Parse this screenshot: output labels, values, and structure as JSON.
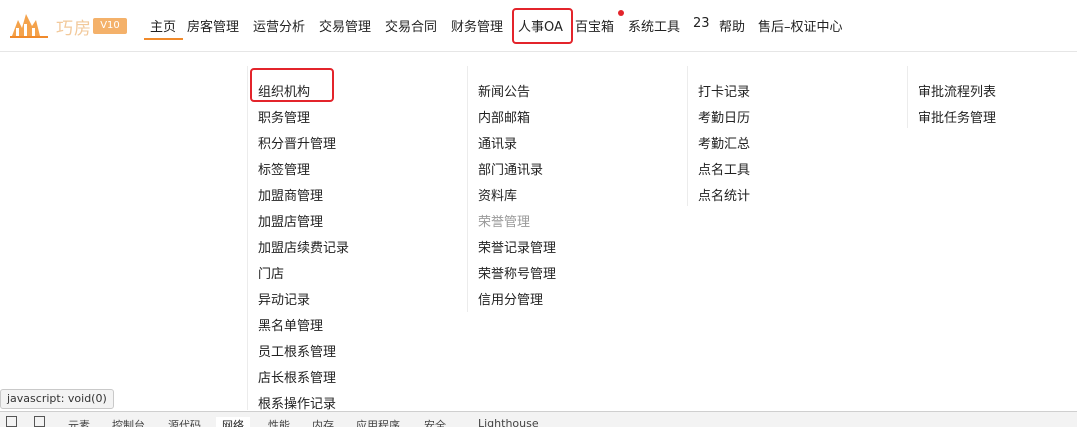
{
  "header": {
    "brand": "巧房",
    "version": "V10",
    "nav": [
      {
        "label": "主页"
      },
      {
        "label": "房客管理"
      },
      {
        "label": "运营分析"
      },
      {
        "label": "交易管理"
      },
      {
        "label": "交易合同"
      },
      {
        "label": "财务管理"
      },
      {
        "label": "人事OA"
      },
      {
        "label": "百宝箱"
      },
      {
        "label": "系统工具"
      },
      {
        "label": "23"
      },
      {
        "label": "帮助"
      },
      {
        "label": "售后–权证中心"
      }
    ],
    "colors": {
      "accent": "#f08a2b",
      "highlight": "#e3242b"
    }
  },
  "menu": {
    "col1": [
      "组织机构",
      "职务管理",
      "积分晋升管理",
      "标签管理",
      "加盟商管理",
      "加盟店管理",
      "加盟店续费记录",
      "门店",
      "异动记录",
      "黑名单管理",
      "员工根系管理",
      "店长根系管理",
      "根系操作记录"
    ],
    "col2": [
      "新闻公告",
      "内部邮箱",
      "通讯录",
      "部门通讯录",
      "资料库",
      "荣誉管理",
      "荣誉记录管理",
      "荣誉称号管理",
      "信用分管理"
    ],
    "col3": [
      "打卡记录",
      "考勤日历",
      "考勤汇总",
      "点名工具",
      "点名统计"
    ],
    "col4": [
      "审批流程列表",
      "审批任务管理"
    ]
  },
  "status_bar": {
    "url": "javascript: void(0)"
  },
  "devtools": {
    "tabs": [
      "元素",
      "控制台",
      "源代码",
      "网络",
      "性能",
      "内存",
      "应用程序",
      "安全",
      "Lighthouse"
    ]
  }
}
